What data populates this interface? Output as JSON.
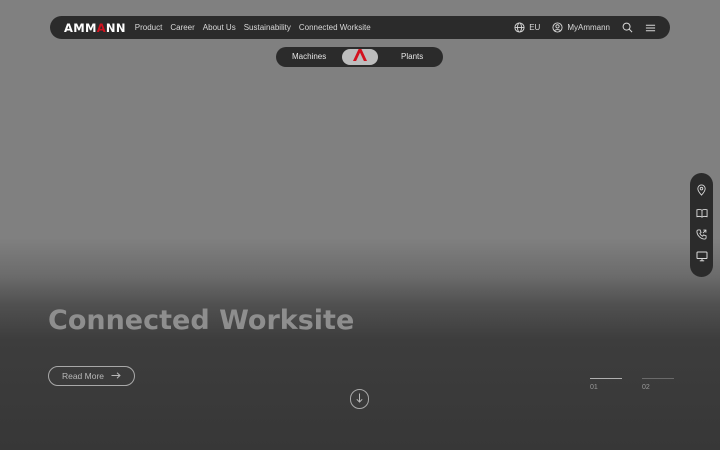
{
  "header": {
    "logo_left": "AMM",
    "logo_accent": "A",
    "logo_right": "NN",
    "nav": [
      {
        "label": "Product"
      },
      {
        "label": "Career"
      },
      {
        "label": "About Us"
      },
      {
        "label": "Sustainability"
      },
      {
        "label": "Connected Worksite"
      }
    ],
    "region_label": "EU",
    "account_label": "MyAmmann",
    "icons": {
      "region": "globe-icon",
      "account": "user-circle-icon",
      "search": "search-icon",
      "menu": "hamburger-menu-icon"
    }
  },
  "switch": {
    "left_label": "Machines",
    "right_label": "Plants",
    "center_icon": "ammann-a-logo-icon"
  },
  "hero": {
    "title": "Connected Worksite",
    "cta_label": "Read More",
    "cta_icon": "arrow-right-icon",
    "scroll_icon": "arrow-down-icon"
  },
  "slides": [
    {
      "number": "01",
      "active": true
    },
    {
      "number": "02",
      "active": false
    }
  ],
  "side_toolbar": [
    {
      "icon": "location-pin-icon"
    },
    {
      "icon": "book-icon"
    },
    {
      "icon": "phone-icon"
    },
    {
      "icon": "monitor-icon"
    }
  ],
  "colors": {
    "brand_red": "#d3111e",
    "bar_background": "#2b2b2b",
    "overlay_gray": "#808080"
  }
}
